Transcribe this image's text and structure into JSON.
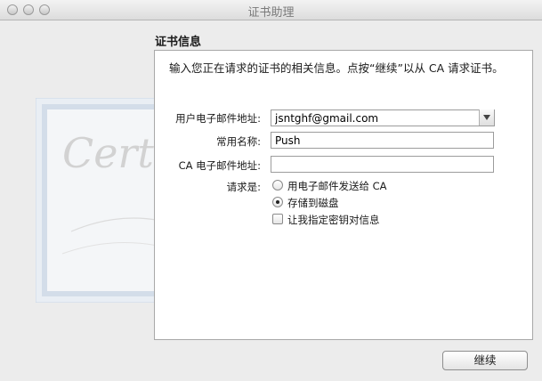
{
  "window": {
    "title": "证书助理"
  },
  "section": {
    "title": "证书信息"
  },
  "intro": {
    "text": "输入您正在请求的证书的相关信息。点按“继续”以从 CA 请求证书。"
  },
  "form": {
    "email": {
      "label": "用户电子邮件地址:",
      "value": "jsntghf@gmail.com"
    },
    "common_name": {
      "label": "常用名称:",
      "value": "Push"
    },
    "ca_email": {
      "label": "CA 电子邮件地址:",
      "value": ""
    },
    "request": {
      "label": "请求是:",
      "options": [
        {
          "label": "用电子邮件发送给 CA",
          "selected": false
        },
        {
          "label": "存储到磁盘",
          "selected": true
        }
      ],
      "checkbox": {
        "label": "让我指定密钥对信息",
        "checked": false
      }
    }
  },
  "certificate_art": {
    "text": "Certificate"
  },
  "buttons": {
    "continue": "继续"
  },
  "colors": {
    "window_bg": "#ececec",
    "panel_bg": "#ffffff",
    "cert_border": "#c9d6e6"
  }
}
